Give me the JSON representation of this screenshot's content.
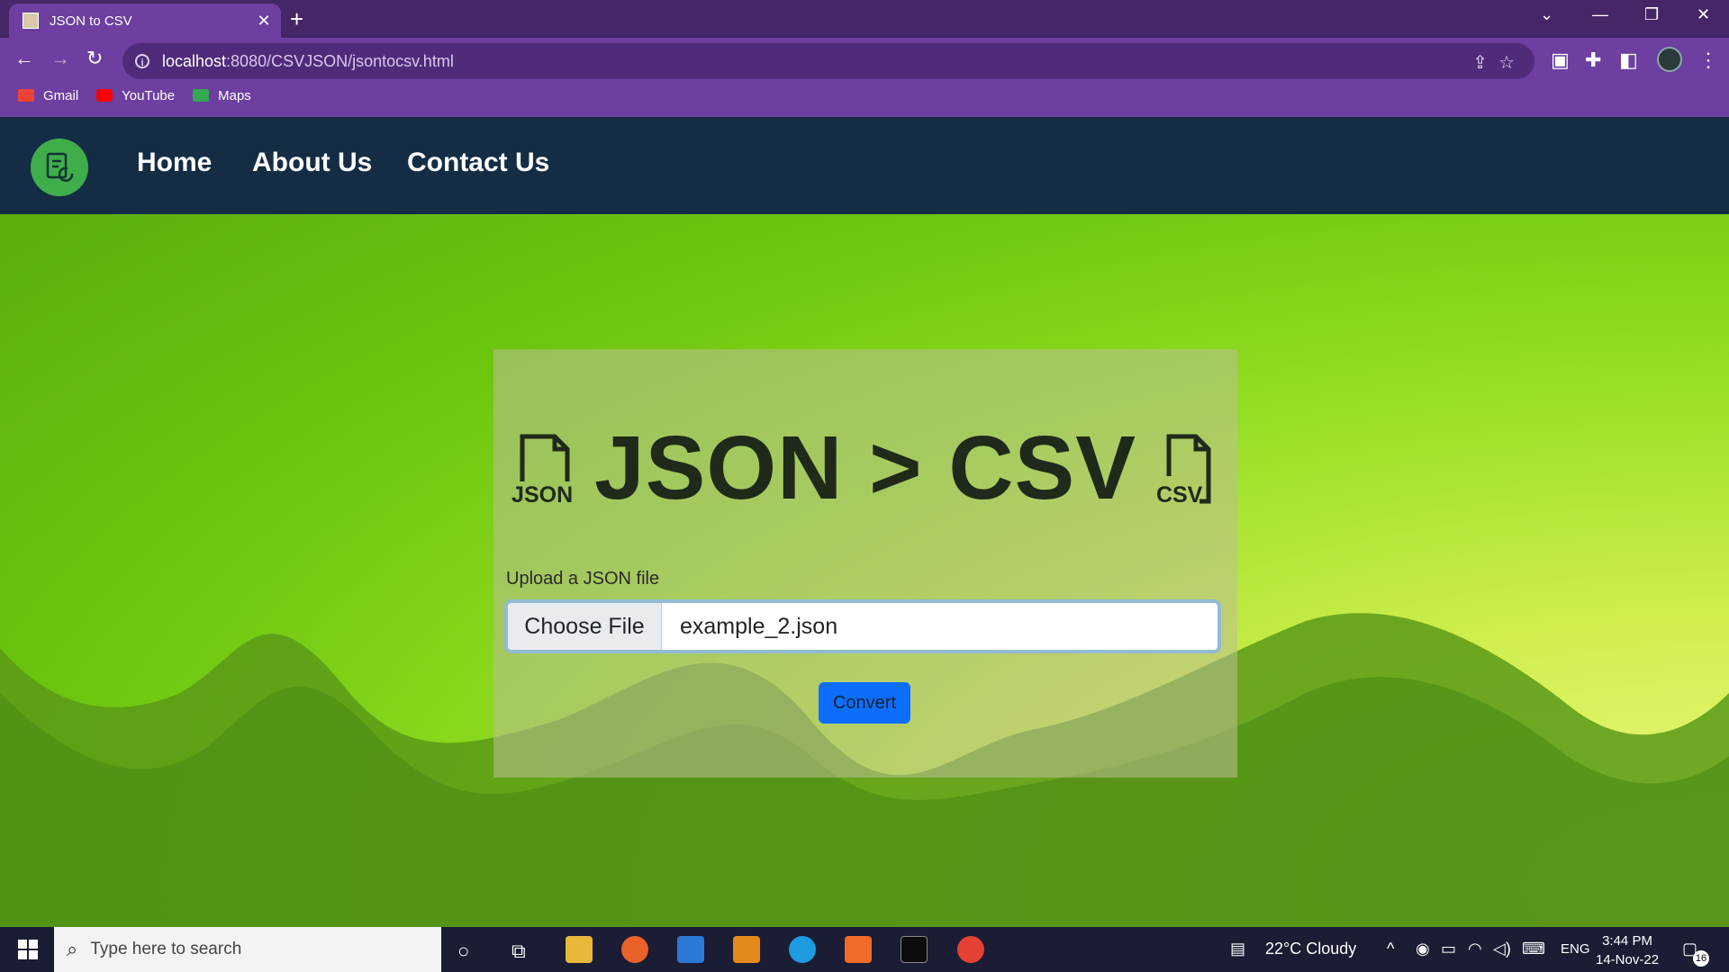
{
  "browser": {
    "tab_title": "JSON to CSV",
    "new_tab": "+",
    "close_tab": "✕",
    "url_host": "localhost",
    "url_rest": ":8080/CSVJSON/jsontocsv.html",
    "bookmarks": [
      {
        "label": "Gmail",
        "icon": "gmail-icon",
        "color": "#ea4335"
      },
      {
        "label": "YouTube",
        "icon": "youtube-icon",
        "color": "#ff0000"
      },
      {
        "label": "Maps",
        "icon": "maps-icon",
        "color": "#34a853"
      }
    ]
  },
  "nav": {
    "links": [
      "Home",
      "About Us",
      "Contact Us"
    ]
  },
  "main": {
    "title": "JSON > CSV",
    "left_icon_label": "JSON",
    "right_icon_label": "CSV",
    "upload_label": "Upload a JSON file",
    "choose_file": "Choose File",
    "file_name": "example_2.json",
    "convert": "Convert"
  },
  "taskbar": {
    "search_placeholder": "Type here to search",
    "weather": "22°C  Cloudy",
    "language": "ENG",
    "time": "3:44 PM",
    "date": "14-Nov-22",
    "notifications": "16"
  },
  "colors": {
    "navbar": "#142d44",
    "accent_button": "#0d6efd",
    "logo": "#3fae4a"
  }
}
